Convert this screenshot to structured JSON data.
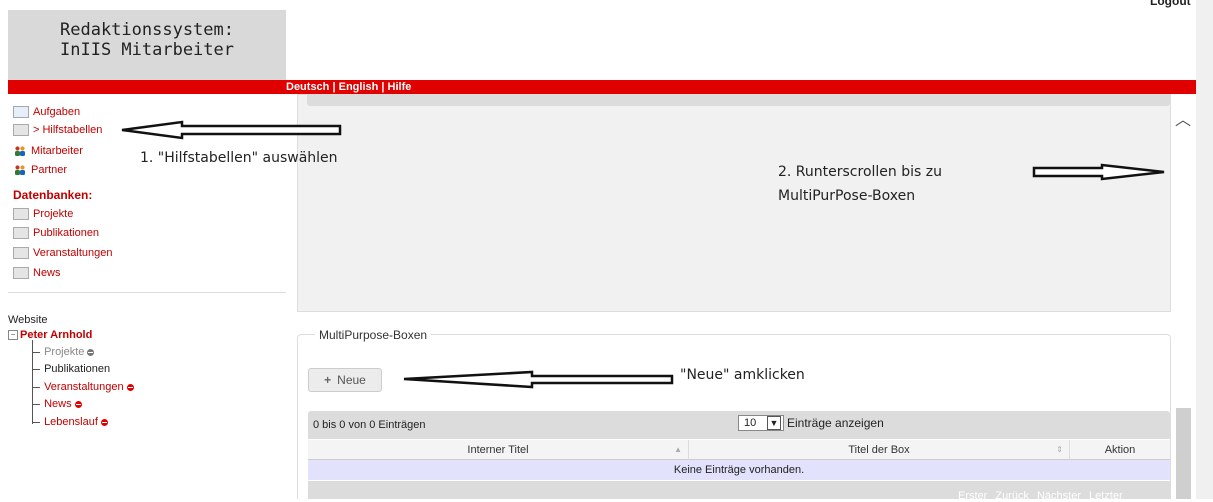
{
  "header": {
    "title_line1": "Redaktionssystem:",
    "title_line2": "InIIS Mitarbeiter",
    "logout": "Logout"
  },
  "langbar": {
    "deutsch": "Deutsch",
    "english": "English",
    "hilfe": "Hilfe",
    "separator": " | "
  },
  "sidebar": {
    "items": [
      {
        "label": "Aufgaben",
        "icon": "envelope-icon"
      },
      {
        "label": "> Hilfstabellen",
        "icon": "table-icon"
      },
      {
        "label": "Mitarbeiter",
        "icon": "people-icon"
      },
      {
        "label": "Partner",
        "icon": "people-icon"
      }
    ],
    "databases_heading": "Datenbanken:",
    "databases": [
      {
        "label": "Projekte"
      },
      {
        "label": "Publikationen"
      },
      {
        "label": "Veranstaltungen"
      },
      {
        "label": "News"
      }
    ]
  },
  "tree": {
    "title": "Website",
    "root": "Peter Arnhold",
    "items": [
      {
        "label": "Projekte",
        "status": "grey",
        "color": "#888888"
      },
      {
        "label": "Publikationen",
        "status": "none",
        "color": "#222222"
      },
      {
        "label": "Veranstaltungen",
        "status": "red",
        "color": "#c00000"
      },
      {
        "label": "News",
        "status": "red",
        "color": "#c00000"
      },
      {
        "label": "Lebenslauf",
        "status": "red",
        "color": "#c00000"
      }
    ]
  },
  "annotations": {
    "step1": "1. \"Hilfstabellen\" auswählen",
    "step2_line1": "2. Runterscrollen bis zu",
    "step2_line2": "MultiPurPose-Boxen",
    "step3": "\"Neue\" amklicken"
  },
  "multipurpose": {
    "legend": "MultiPurpose-Boxen",
    "new_button": "Neue",
    "info": "0 bis 0 von 0 Einträgen",
    "page_size": "10",
    "page_size_suffix": "Einträge anzeigen",
    "columns": [
      "Interner Titel",
      "Titel der Box",
      "Aktion"
    ],
    "empty": "Keine Einträge vorhanden.",
    "pager": [
      "Erster",
      "Zurück",
      "Nächster",
      "Letzter"
    ]
  },
  "colors": {
    "accent_red": "#e00000",
    "link_red": "#c00000",
    "empty_row": "#e2e2fc"
  }
}
